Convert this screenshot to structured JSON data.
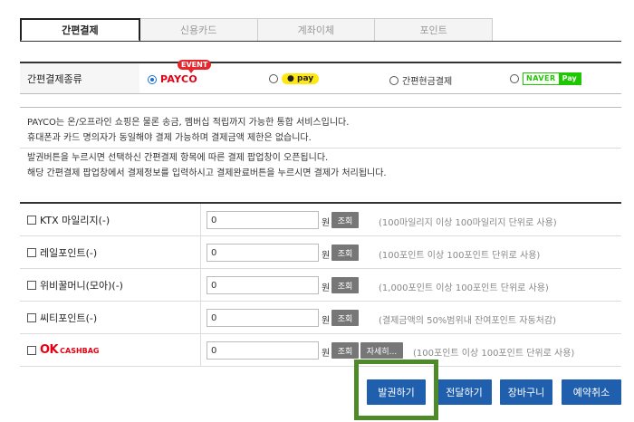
{
  "tabs": [
    {
      "label": "간편결제",
      "active": true
    },
    {
      "label": "신용카드",
      "active": false
    },
    {
      "label": "계좌이체",
      "active": false
    },
    {
      "label": "포인트",
      "active": false
    }
  ],
  "payment_type": {
    "label": "간편결제종류",
    "event_badge": "EVENT",
    "options": {
      "payco": {
        "label": "PAYCO",
        "checked": true
      },
      "kakaopay": {
        "label": "pay",
        "checked": false
      },
      "cash": {
        "label": "간편현금결제",
        "checked": false
      },
      "naverpay": {
        "brand": "NAVER",
        "label": "Pay",
        "checked": false
      }
    }
  },
  "info": {
    "line1": "PAYCO는 온/오프라인 쇼핑은 물론 송금, 멤버십 적립까지 가능한 통합 서비스입니다.",
    "line2": "휴대폰과 카드 명의자가 동일해야 결제 가능하며 결제금액 제한은 없습니다.",
    "line3": "발권버튼을 누르시면 선택하신 간편결제 항목에 따른 결제 팝업창이 오픈됩니다.",
    "line4": "해당 간편결제 팝업창에서 결제정보를 입력하시고 결제완료버튼을 누르시면 결제가 처리됩니다."
  },
  "points": [
    {
      "label": "KTX 마일리지(-)",
      "value": "0",
      "unit": "원",
      "check_label": "조회",
      "note": "(100마일리지 이상 100마일리지 단위로 사용)"
    },
    {
      "label": "레일포인트(-)",
      "value": "0",
      "unit": "원",
      "check_label": "조회",
      "note": "(100포인트 이상 100포인트 단위로 사용)"
    },
    {
      "label": "위비꿀머니(모아)(-)",
      "value": "0",
      "unit": "원",
      "check_label": "조회",
      "note": "(1,000포인트 이상 100포인트 단위로 사용)"
    },
    {
      "label": "씨티포인트(-)",
      "value": "0",
      "unit": "원",
      "check_label": "조회",
      "note": "(결제금액의 50%범위내 잔여포인트 자동처감)"
    },
    {
      "label_ok": "OK",
      "label_cashbag": "CASHBAG",
      "value": "0",
      "unit": "원",
      "check_label": "조회",
      "detail_label": "자세히...",
      "note": "(100포인트 이상 100포인트 단위로 사용)"
    }
  ],
  "buttons": {
    "issue": "발권하기",
    "send": "전달하기",
    "cart": "장바구니",
    "cancel": "예약취소"
  },
  "colors": {
    "button_blue": "#1f5fae",
    "highlight_green": "#4f8a2a",
    "payco_red": "#e60012"
  }
}
